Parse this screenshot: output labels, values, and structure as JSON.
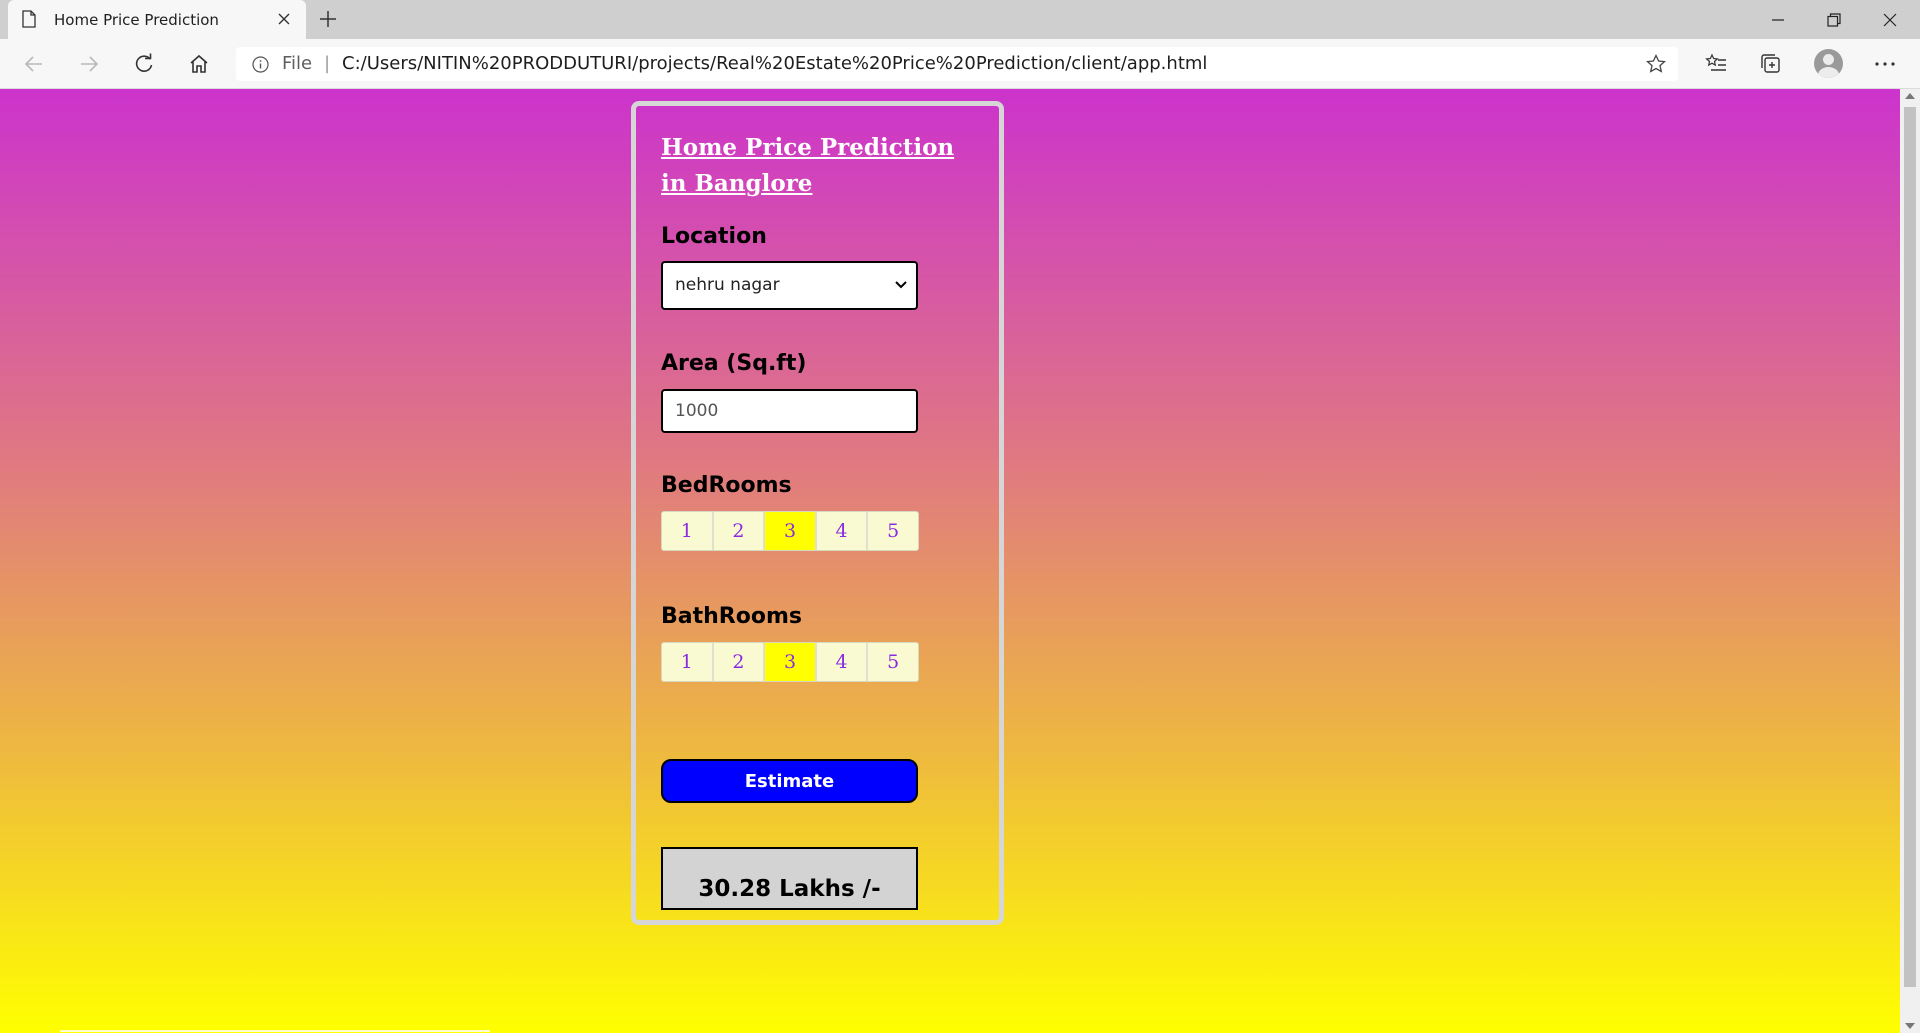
{
  "browser": {
    "tab_title": "Home Price Prediction",
    "address_prefix": "File",
    "address_separator": "|",
    "url": "C:/Users/NITIN%20PRODDUTURI/projects/Real%20Estate%20Price%20Prediction/client/app.html"
  },
  "page": {
    "title": "Home Price Prediction in Banglore",
    "location_label": "Location",
    "location_value": "nehru nagar",
    "area_label": "Area (Sq.ft)",
    "area_value": "1000",
    "bedrooms_label": "BedRooms",
    "bedrooms_options": [
      "1",
      "2",
      "3",
      "4",
      "5"
    ],
    "bedrooms_selected": "3",
    "bathrooms_label": "BathRooms",
    "bathrooms_options": [
      "1",
      "2",
      "3",
      "4",
      "5"
    ],
    "bathrooms_selected": "3",
    "estimate_label": "Estimate",
    "result_text": "30.28 Lakhs /-"
  },
  "colors": {
    "gradient_top": "#cc33cc",
    "gradient_bottom": "#ffff00",
    "estimate_button": "#0000ff",
    "selected_option": "#ffff00",
    "option_text": "#8a2be2",
    "result_box": "#d3d3d3"
  }
}
